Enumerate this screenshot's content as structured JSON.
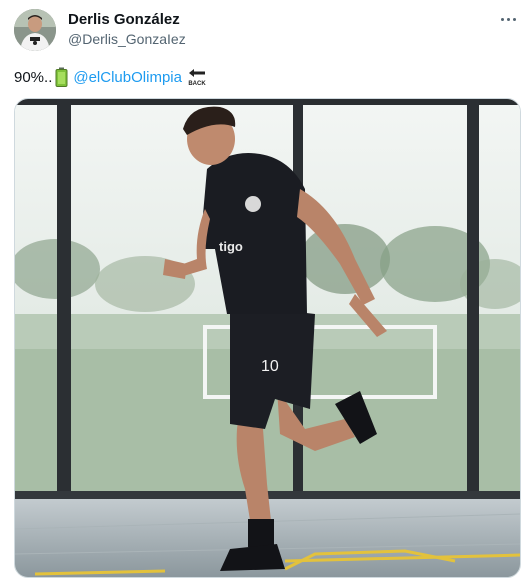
{
  "author": {
    "display_name": "Derlis González",
    "handle": "@Derlis_GonzaIez",
    "avatar_icon": "profile-photo"
  },
  "tweet": {
    "text_prefix": "90%..",
    "mention": "@elClubOlimpia",
    "emoji_battery": "battery-icon",
    "emoji_back": "back-arrow-icon",
    "back_text": "BACK"
  },
  "media": {
    "jersey_number": "10",
    "sponsor": "tigo",
    "photo_subject": "player-training-photo"
  },
  "colors": {
    "mention": "#1d9bf0",
    "handle": "#536471",
    "text": "#0f1419"
  }
}
